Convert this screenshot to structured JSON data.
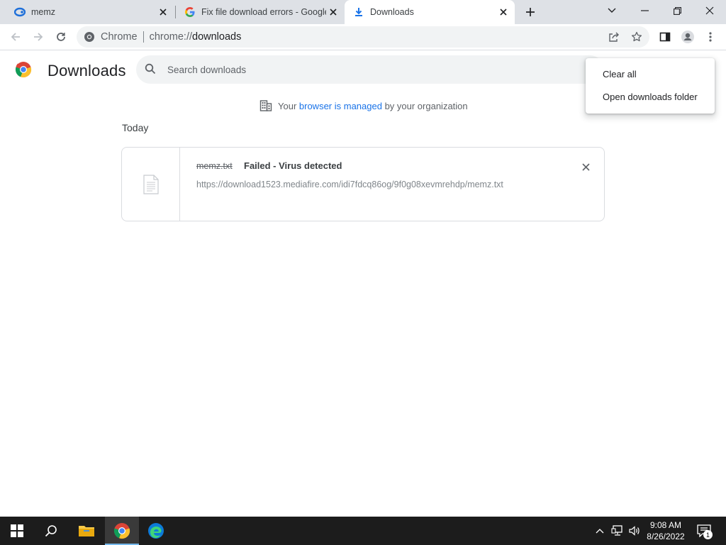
{
  "tabs": [
    {
      "title": "memz",
      "icon": "edge-tab-icon",
      "active": false
    },
    {
      "title": "Fix file download errors - Google",
      "icon": "google-tab-icon",
      "active": false
    },
    {
      "title": "Downloads",
      "icon": "download-tab-icon",
      "active": true
    }
  ],
  "omnibox": {
    "site_label": "Chrome",
    "url_scheme": "chrome://",
    "url_path": "downloads"
  },
  "page": {
    "title": "Downloads",
    "search_placeholder": "Search downloads"
  },
  "managed_notice": {
    "prefix": "Your ",
    "link": "browser is managed",
    "suffix": " by your organization"
  },
  "section": {
    "date_label": "Today"
  },
  "downloads": [
    {
      "file_name": "memz.txt",
      "status": "Failed - Virus detected",
      "url": "https://download1523.mediafire.com/idi7fdcq86og/9f0g08xevmrehdp/memz.txt"
    }
  ],
  "menu": {
    "items": [
      "Clear all",
      "Open downloads folder"
    ]
  },
  "taskbar": {
    "time": "9:08 AM",
    "date": "8/26/2022",
    "notification_count": "1"
  },
  "colors": {
    "accent_link": "#1a73e8",
    "tabstrip_bg": "#dee1e6",
    "taskbar_bg": "#1c1c1c"
  }
}
